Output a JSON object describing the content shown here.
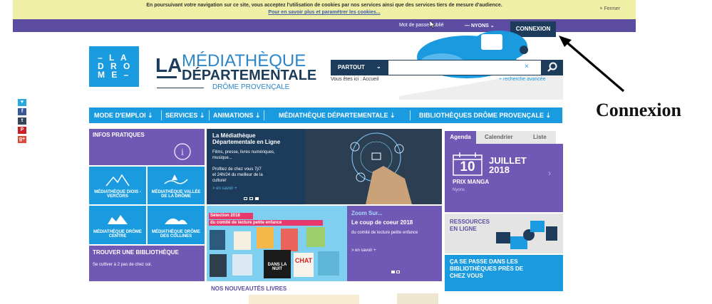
{
  "cookie": {
    "line1": "En poursuivant votre navigation sur ce site, vous acceptez l'utilisation de cookies par nos services ainsi que des services tiers de mesure d'audience.",
    "line2": "Pour en savoir plus et paramétrer les cookies...",
    "close_label": "×  Fermer"
  },
  "topbar": {
    "forgot_password": "Mot de passe oublié",
    "location": "—  NYONS ⌄",
    "connexion_button": "CONNEXION"
  },
  "logo": {
    "box_lines": [
      "– L A",
      "D R O",
      "M E –"
    ],
    "la": "LA",
    "mediatheque": "MÉDIATHÈQUE",
    "departementale": "DÉPARTEMENTALE",
    "drome": "DRÔME PROVENÇALE"
  },
  "search": {
    "scope_label": "PARTOUT",
    "scope_chevron": "⌄",
    "placeholder": "",
    "clear_icon": "×",
    "breadcrumb": "Vous êtes ici :  Accueil",
    "advanced": "+  recherche avancée"
  },
  "nav": {
    "items": [
      "MODE D'EMPLOI ⇣",
      "SERVICES ⇣",
      "ANIMATIONS ⇣",
      "MÉDIATHÈQUE DÉPARTEMENTALE    ⇣",
      "BIBLIOTHÈQUES DRÔME PROVENÇALE    ⇣"
    ]
  },
  "social": [
    "twitter-icon",
    "facebook-icon",
    "tumblr-icon",
    "pinterest-icon",
    "googleplus-icon"
  ],
  "social_glyphs": [
    "♥",
    "f",
    "t",
    "P",
    "g+"
  ],
  "infos": {
    "title": "INFOS PRATIQUES",
    "tiles": [
      "MÉDIATHÈQUE DIOIS - VERCORS",
      "MÉDIATHÈQUE VALLÉE DE LA DRÔME",
      "MÉDIATHÈQUE DRÔME CENTRE",
      "MÉDIATHÈQUE DRÔME DES COLLINES"
    ],
    "trouver_title": "TROUVER UNE BIBLIOTHÈQUE",
    "trouver_text": "Se cultiver à 2 pas de chez soi."
  },
  "feature": {
    "title": "La Médiathèque Départementale en Ligne",
    "desc1": "Films, presse, livres numériques, musique...",
    "desc2": "Profitez de chez vous 7j/7 et 24h/24 du meilleur de la culture!",
    "more": "> en savoir +"
  },
  "zoom": {
    "title": "Zoom Sur...",
    "subtitle": "Le coup de coeur 2018",
    "text": "du comité de lecture petite enfance",
    "more": "> en savoir +",
    "banner1": "Sélection 2018",
    "banner2": "du comité de lecture petite enfance",
    "book1": "DANS LA NUIT",
    "book2": "CHAT"
  },
  "agenda": {
    "tabs": [
      "Agenda",
      "Calendrier",
      "Liste"
    ],
    "day": "10",
    "month": "JUILLET",
    "year": "2018",
    "event": "PRIX MANGA",
    "place": "Nyons"
  },
  "ressources": {
    "title": "RESSOURCES EN LIGNE"
  },
  "casepasse": {
    "title": "ÇA SE PASSE DANS LES BIBLIOTHÈQUES PRÈS DE CHEZ VOUS"
  },
  "nouveautes": {
    "title": "NOS NOUVEAUTÉS LIVRES"
  },
  "annotation": {
    "label": "Connexion"
  },
  "colors": {
    "purple": "#5c4da3",
    "blue": "#1a9be0",
    "navy": "#1d3c5c"
  }
}
